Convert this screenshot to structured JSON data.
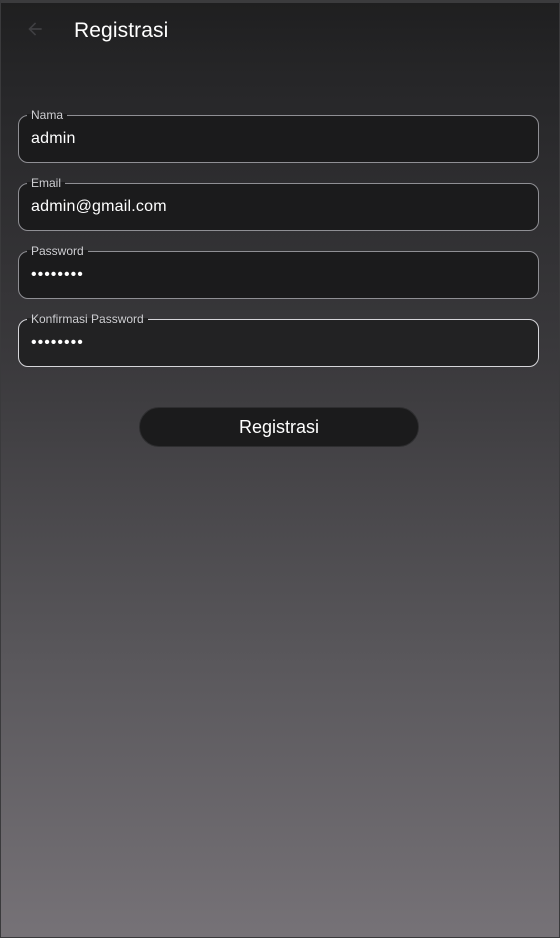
{
  "appbar": {
    "back_icon": "arrow-left-icon",
    "title": "Registrasi"
  },
  "form": {
    "nama": {
      "label": "Nama",
      "value": "admin"
    },
    "email": {
      "label": "Email",
      "value": "admin@gmail.com"
    },
    "password": {
      "label": "Password",
      "value": "••••••••"
    },
    "konfirmasi": {
      "label": "Konfirmasi Password",
      "value": "••••••••"
    }
  },
  "submit_label": "Registrasi",
  "colors": {
    "field_background": "#1b1b1c",
    "field_border": "#8f8f94",
    "focused_border": "#d6d6da",
    "text": "#ffffff"
  }
}
